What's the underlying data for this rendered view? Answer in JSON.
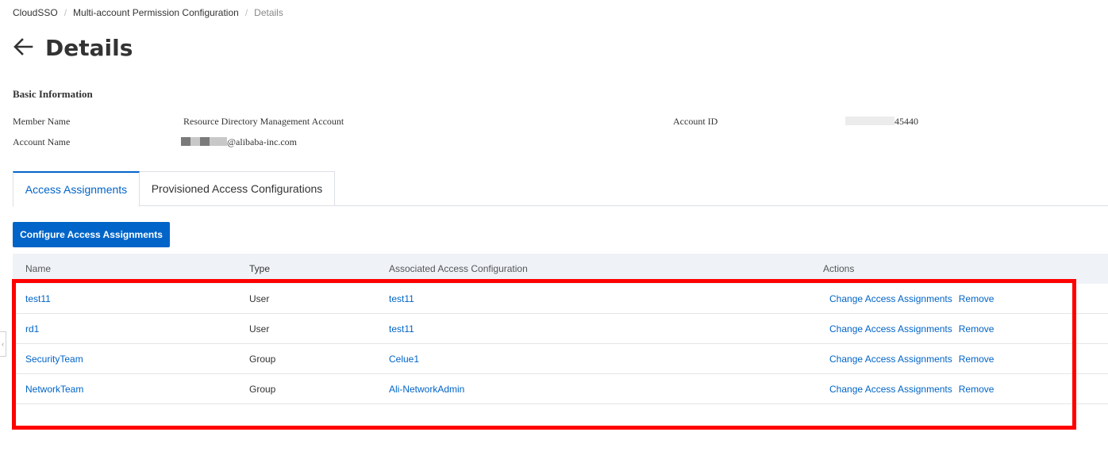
{
  "breadcrumb": {
    "items": [
      "CloudSSO",
      "Multi-account Permission Configuration",
      "Details"
    ],
    "separator": "/"
  },
  "header": {
    "title": "Details",
    "back_icon": "arrow-left-icon"
  },
  "basic_info": {
    "section_title": "Basic Information",
    "member_name_label": "Member Name",
    "member_name_value": "Resource Directory Management Account",
    "account_name_label": "Account Name",
    "account_name_value_suffix": "@alibaba-inc.com",
    "account_id_label": "Account ID",
    "account_id_value_suffix": "45440"
  },
  "tabs": [
    {
      "label": "Access Assignments",
      "active": true
    },
    {
      "label": "Provisioned Access Configurations",
      "active": false
    }
  ],
  "toolbar": {
    "configure_label": "Configure Access Assignments"
  },
  "table": {
    "columns": [
      "Name",
      "Type",
      "Associated Access Configuration",
      "Actions"
    ],
    "rows": [
      {
        "name": "test11",
        "type": "User",
        "config": "test11",
        "action_change": "Change Access Assignments",
        "action_remove": "Remove"
      },
      {
        "name": "rd1",
        "type": "User",
        "config": "test11",
        "action_change": "Change Access Assignments",
        "action_remove": "Remove"
      },
      {
        "name": "SecurityTeam",
        "type": "Group",
        "config": "Celue1",
        "action_change": "Change Access Assignments",
        "action_remove": "Remove"
      },
      {
        "name": "NetworkTeam",
        "type": "Group",
        "config": "Ali-NetworkAdmin",
        "action_change": "Change Access Assignments",
        "action_remove": "Remove"
      }
    ]
  },
  "colors": {
    "primary": "#0064c8",
    "highlight": "#ff0000",
    "table_header_bg": "#eff3f8"
  }
}
